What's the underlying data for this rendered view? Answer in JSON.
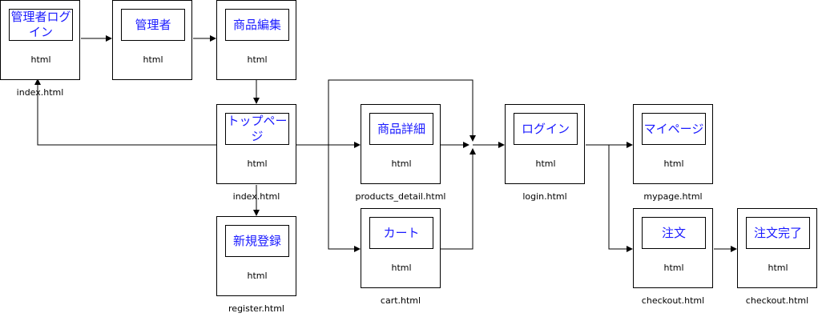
{
  "nodes": [
    {
      "id": "admin-login",
      "title": "管理者ログイン",
      "type": "html",
      "file": "index.html"
    },
    {
      "id": "admin",
      "title": "管理者",
      "type": "html",
      "file": ""
    },
    {
      "id": "product-edit",
      "title": "商品編集",
      "type": "html",
      "file": ""
    },
    {
      "id": "top-page",
      "title": "トップページ",
      "type": "html",
      "file": "index.html"
    },
    {
      "id": "register",
      "title": "新規登録",
      "type": "html",
      "file": "register.html"
    },
    {
      "id": "product-detail",
      "title": "商品詳細",
      "type": "html",
      "file": "products_detail.html"
    },
    {
      "id": "cart",
      "title": "カート",
      "type": "html",
      "file": "cart.html"
    },
    {
      "id": "login",
      "title": "ログイン",
      "type": "html",
      "file": "login.html"
    },
    {
      "id": "mypage",
      "title": "マイページ",
      "type": "html",
      "file": "mypage.html"
    },
    {
      "id": "order",
      "title": "注文",
      "type": "html",
      "file": "checkout.html"
    },
    {
      "id": "order-complete",
      "title": "注文完了",
      "type": "html",
      "file": "checkout.html"
    }
  ]
}
